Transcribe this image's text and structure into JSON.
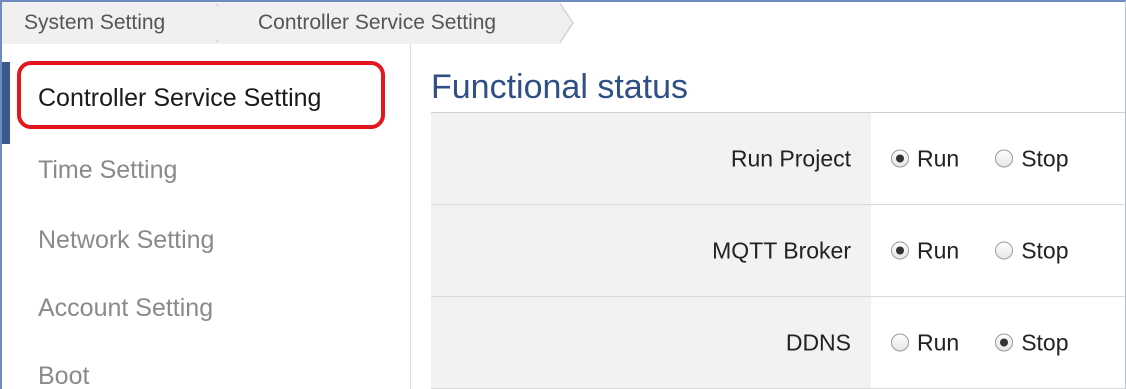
{
  "breadcrumb": {
    "items": [
      "System Setting",
      "Controller Service Setting"
    ]
  },
  "sidebar": {
    "items": [
      {
        "label": "Controller Service Setting",
        "active": true
      },
      {
        "label": "Time Setting",
        "active": false
      },
      {
        "label": "Network Setting",
        "active": false
      },
      {
        "label": "Account Setting",
        "active": false
      },
      {
        "label": "Boot",
        "active": false
      }
    ]
  },
  "main": {
    "title": "Functional status",
    "rows": [
      {
        "label": "Run Project",
        "options": [
          "Run",
          "Stop"
        ],
        "selected": "Run"
      },
      {
        "label": "MQTT Broker",
        "options": [
          "Run",
          "Stop"
        ],
        "selected": "Run"
      },
      {
        "label": "DDNS",
        "options": [
          "Run",
          "Stop"
        ],
        "selected": "Stop"
      }
    ]
  },
  "colors": {
    "title": "#2f4f86",
    "active_bar": "#3a5a8c",
    "highlight": "#e5151d",
    "inactive_text": "#8a8a8a"
  }
}
